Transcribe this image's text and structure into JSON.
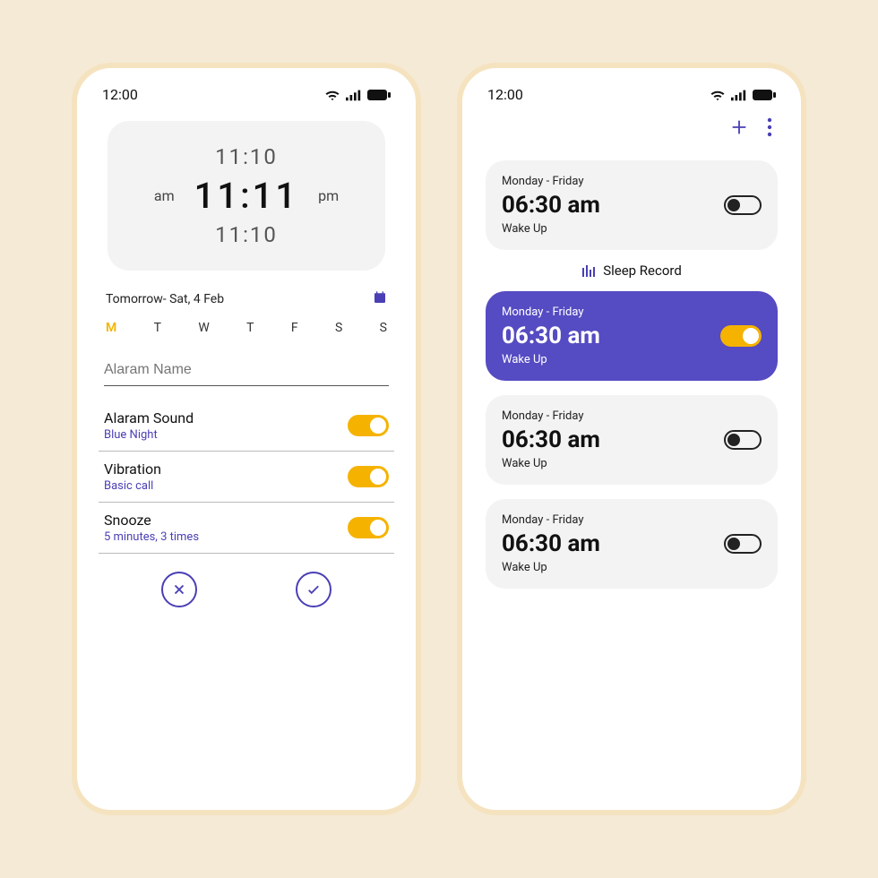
{
  "status": {
    "time": "12:00"
  },
  "left": {
    "picker": {
      "above": "11:10",
      "am": "am",
      "main": "11:11",
      "pm": "pm",
      "below": "11:10"
    },
    "date_text": "Tomorrow- Sat, 4 Feb",
    "weekdays": [
      "M",
      "T",
      "W",
      "T",
      "F",
      "S",
      "S"
    ],
    "alarm_name_placeholder": "Alaram Name",
    "settings": [
      {
        "label": "Alaram Sound",
        "sub": "Blue Night"
      },
      {
        "label": "Vibration",
        "sub": "Basic call"
      },
      {
        "label": "Snooze",
        "sub": "5 minutes, 3 times"
      }
    ]
  },
  "right": {
    "sleep_record": "Sleep Record",
    "alarms": [
      {
        "days": "Monday - Friday",
        "time": "06:30 am",
        "label": "Wake Up",
        "active": false
      },
      {
        "days": "Monday - Friday",
        "time": "06:30 am",
        "label": "Wake Up",
        "active": true
      },
      {
        "days": "Monday - Friday",
        "time": "06:30 am",
        "label": "Wake Up",
        "active": false
      },
      {
        "days": "Monday - Friday",
        "time": "06:30 am",
        "label": "Wake Up",
        "active": false
      }
    ]
  }
}
